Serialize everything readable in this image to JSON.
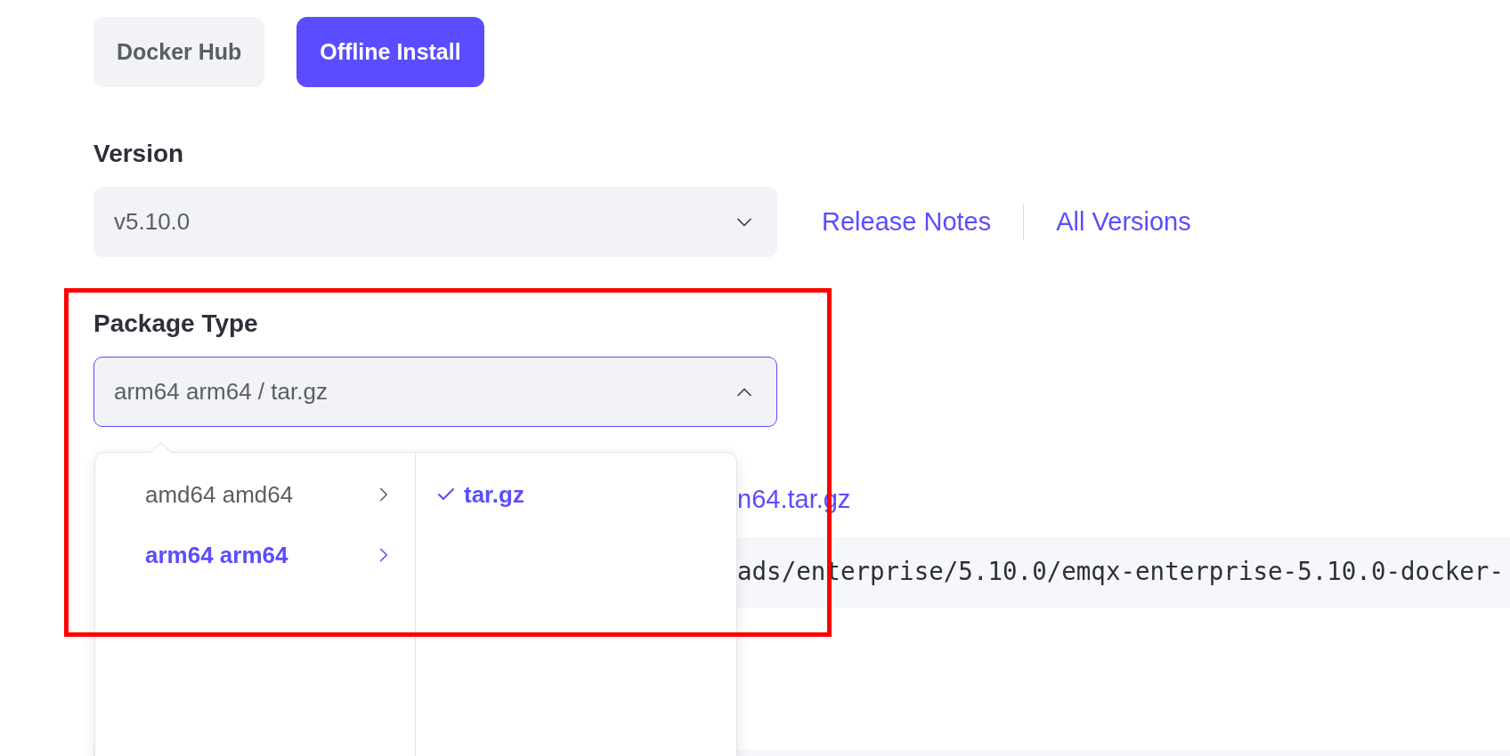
{
  "tabs": [
    {
      "label": "Docker Hub",
      "selected": false
    },
    {
      "label": "Offline Install",
      "selected": true
    }
  ],
  "version": {
    "label": "Version",
    "value": "v5.10.0",
    "expanded": false,
    "links": [
      "Release Notes",
      "All Versions"
    ]
  },
  "package_type": {
    "label": "Package Type",
    "value": "arm64 arm64 / tar.gz",
    "expanded": true
  },
  "dropdown": {
    "architectures": [
      {
        "label": "amd64 amd64",
        "selected": false
      },
      {
        "label": "arm64 arm64",
        "selected": true
      }
    ],
    "formats": [
      {
        "label": "tar.gz",
        "selected": true
      }
    ]
  },
  "download_link": "n64.tar.gz",
  "command": "ads/enterprise/5.10.0/emqx-enterprise-5.10.0-docker-"
}
